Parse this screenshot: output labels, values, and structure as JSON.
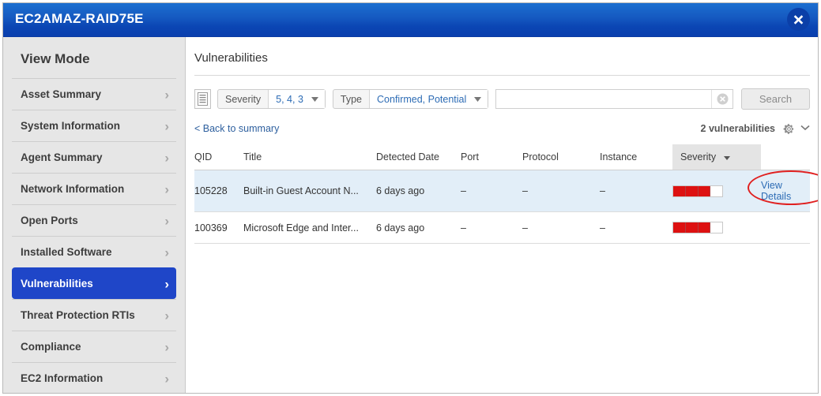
{
  "window": {
    "title": "EC2AMAZ-RAID75E",
    "close_label": "✕"
  },
  "sidebar": {
    "title": "View Mode",
    "items": [
      {
        "label": "Asset Summary",
        "active": false
      },
      {
        "label": "System Information",
        "active": false
      },
      {
        "label": "Agent Summary",
        "active": false
      },
      {
        "label": "Network Information",
        "active": false
      },
      {
        "label": "Open Ports",
        "active": false
      },
      {
        "label": "Installed Software",
        "active": false
      },
      {
        "label": "Vulnerabilities",
        "active": true
      },
      {
        "label": "Threat Protection RTIs",
        "active": false
      },
      {
        "label": "Compliance",
        "active": false
      },
      {
        "label": "EC2 Information",
        "active": false
      }
    ],
    "chevron": "›"
  },
  "main": {
    "heading": "Vulnerabilities",
    "toolbar": {
      "list_icon": "document-list-icon",
      "filters": [
        {
          "key": "Severity",
          "value": "5, 4, 3",
          "caret": "▾"
        },
        {
          "key": "Type",
          "value": "Confirmed, Potential",
          "caret": "▾"
        }
      ],
      "search_value": "",
      "search_placeholder": "",
      "clear_icon": "clear-x-icon",
      "search_button": "Search"
    },
    "subrow": {
      "back_link": "< Back to summary",
      "count": "2 vulnerabilities",
      "gear_icon": "gear-icon",
      "chevron_down": "⌄"
    },
    "table": {
      "columns": [
        "QID",
        "Title",
        "Detected Date",
        "Port",
        "Protocol",
        "Instance",
        "Severity",
        ""
      ],
      "sort_column": "Severity",
      "sort_caret": "▾",
      "rows": [
        {
          "qid": "105228",
          "title": "Built-in Guest Account N...",
          "detected_date": "6 days ago",
          "port": "–",
          "protocol": "–",
          "instance": "–",
          "severity_filled": 3,
          "severity_total": 4,
          "action": "View Details",
          "highlighted": true,
          "annotated": true
        },
        {
          "qid": "100369",
          "title": "Microsoft Edge and Inter...",
          "detected_date": "6 days ago",
          "port": "–",
          "protocol": "–",
          "instance": "–",
          "severity_filled": 3,
          "severity_total": 4,
          "action": "",
          "highlighted": false,
          "annotated": false
        }
      ]
    }
  },
  "colors": {
    "title_bar_blue": "#1558c0",
    "active_nav_blue": "#1f46c8",
    "link_blue": "#2d6cb5",
    "severity_red": "#dd1111",
    "annotation_red": "#e02020",
    "row_highlight": "#e2eef8"
  }
}
